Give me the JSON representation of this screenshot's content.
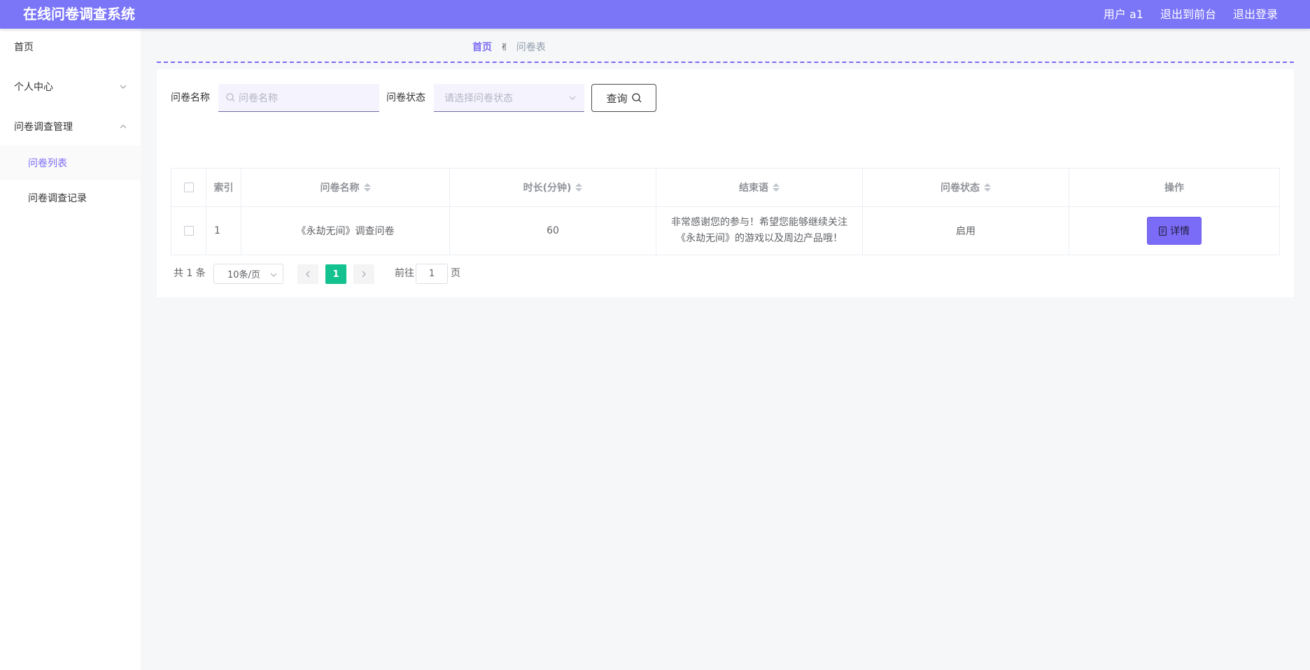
{
  "header": {
    "title": "在线问卷调查系统",
    "user": "用户 a1",
    "to_front": "退出到前台",
    "logout": "退出登录"
  },
  "sidebar": {
    "home": "首页",
    "personal_center": "个人中心",
    "survey_mgmt": "问卷调查管理",
    "survey_list": "问卷列表",
    "survey_records": "问卷调查记录"
  },
  "breadcrumb": {
    "home": "首页",
    "separator_icon": "victory-hand-icon",
    "separator": "✌",
    "current": "问卷表"
  },
  "filters": {
    "name_label": "问卷名称",
    "name_placeholder": "问卷名称",
    "status_label": "问卷状态",
    "status_placeholder": "请选择问卷状态",
    "query_label": "查询"
  },
  "table": {
    "headers": {
      "index": "索引",
      "name": "问卷名称",
      "duration": "时长(分钟)",
      "ending": "结束语",
      "status": "问卷状态",
      "actions": "操作"
    },
    "rows": [
      {
        "index": "1",
        "name": "《永劫无间》调查问卷",
        "duration": "60",
        "ending_line1": "非常感谢您的参与！希望您能够继续关注",
        "ending_line2": "《永劫无间》的游戏以及周边产品哦！",
        "status": "启用",
        "action_label": "详情"
      }
    ]
  },
  "pagination": {
    "total": "共 1 条",
    "page_size": "10条/页",
    "current_page": "1",
    "goto_label": "前往",
    "goto_value": "1",
    "page_suffix": "页"
  },
  "colors": {
    "topbar": "#7b75f8",
    "accent": "#7b6cf6",
    "current_page": "#13c28e"
  }
}
